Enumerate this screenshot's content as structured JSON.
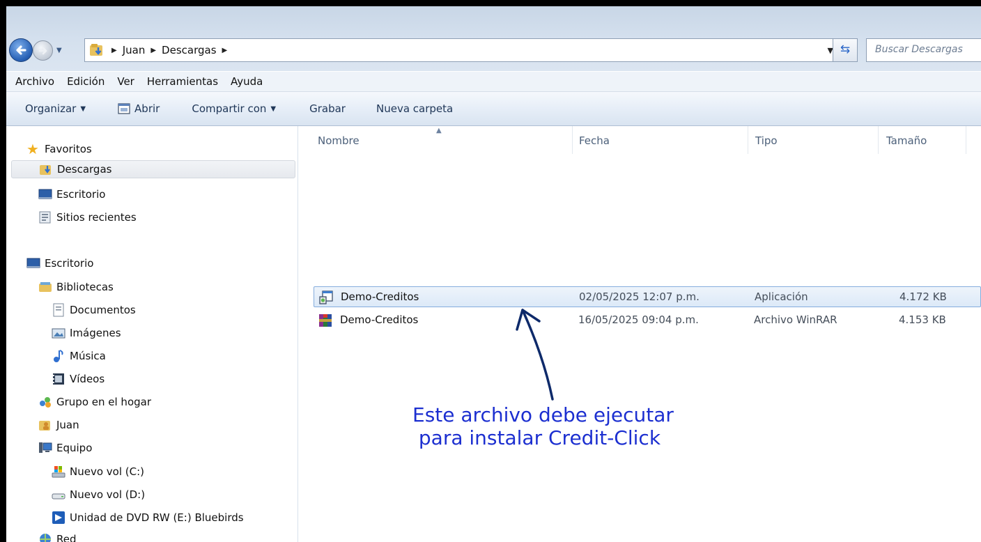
{
  "address_bar": {
    "breadcrumbs": [
      "Juan",
      "Descargas"
    ],
    "search_placeholder": "Buscar Descargas"
  },
  "menu": [
    "Archivo",
    "Edición",
    "Ver",
    "Herramientas",
    "Ayuda"
  ],
  "command_bar": {
    "organize": "Organizar",
    "open": "Abrir",
    "share": "Compartir con",
    "burn": "Grabar",
    "new_folder": "Nueva carpeta"
  },
  "nav": {
    "favorites": "Favoritos",
    "downloads": "Descargas",
    "desktop_fav": "Escritorio",
    "recent": "Sitios recientes",
    "desktop": "Escritorio",
    "libraries": "Bibliotecas",
    "documents": "Documentos",
    "images": "Imágenes",
    "music": "Música",
    "videos": "Vídeos",
    "homegroup": "Grupo en el hogar",
    "user": "Juan",
    "computer": "Equipo",
    "drive_c": "Nuevo vol (C:)",
    "drive_d": "Nuevo vol (D:)",
    "dvd": "Unidad de DVD RW (E:) Bluebirds",
    "network": "Red"
  },
  "columns": {
    "name": "Nombre",
    "date": "Fecha",
    "type": "Tipo",
    "size": "Tamaño"
  },
  "files": [
    {
      "name": "Demo-Creditos",
      "date": "02/05/2025 12:07 p.m.",
      "type": "Aplicación",
      "size": "4.172 KB",
      "icon": "installer-icon"
    },
    {
      "name": "Demo-Creditos",
      "date": "16/05/2025 09:04 p.m.",
      "type": "Archivo WinRAR",
      "size": "4.153 KB",
      "icon": "winrar-icon"
    }
  ],
  "annotation": {
    "line1": "Este archivo debe ejecutar",
    "line2": " para instalar Credit-Click",
    "color": "#1c2fd0"
  }
}
